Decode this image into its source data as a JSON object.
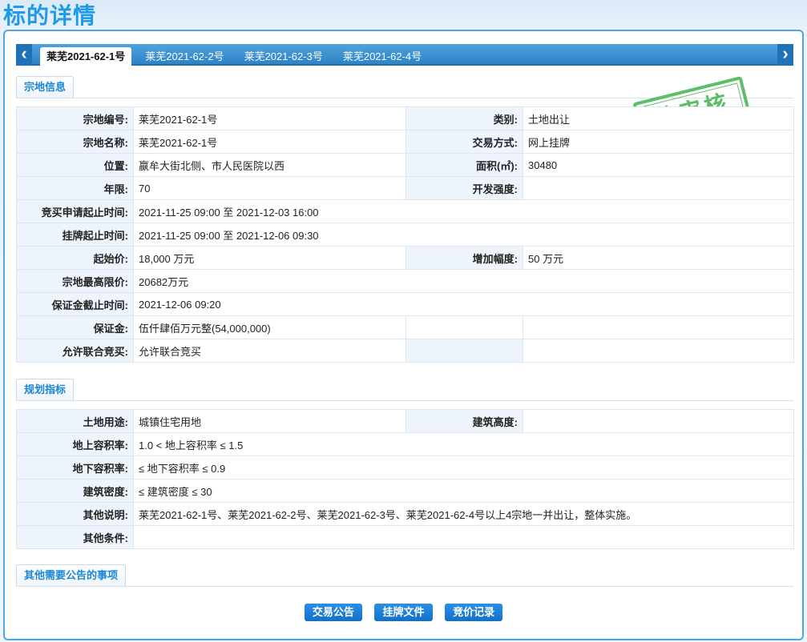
{
  "page_title": "标的详情",
  "tabs": [
    "莱芜2021-62-1号",
    "莱芜2021-62-2号",
    "莱芜2021-62-3号",
    "莱芜2021-62-4号"
  ],
  "stamp_text": "待审核",
  "section1": {
    "title": "宗地信息",
    "land_no_label": "宗地编号:",
    "land_no": "莱芜2021-62-1号",
    "category_label": "类别:",
    "category": "土地出让",
    "land_name_label": "宗地名称:",
    "land_name": "莱芜2021-62-1号",
    "trade_method_label": "交易方式:",
    "trade_method": "网上挂牌",
    "location_label": "位置:",
    "location": "嬴牟大街北侧、市人民医院以西",
    "area_label": "面积(㎡):",
    "area": "30480",
    "term_label": "年限:",
    "term": "70",
    "dev_intensity_label": "开发强度:",
    "dev_intensity": "",
    "bid_apply_period_label": "竞买申请起止时间:",
    "bid_apply_period": "2021-11-25 09:00 至 2021-12-03 16:00",
    "listing_period_label": "挂牌起止时间:",
    "listing_period": "2021-11-25 09:00 至 2021-12-06 09:30",
    "start_price_label": "起始价:",
    "start_price": "18,000 万元",
    "increment_label": "增加幅度:",
    "increment": "50 万元",
    "max_price_label": "宗地最高限价:",
    "max_price": "20682万元",
    "deposit_deadline_label": "保证金截止时间:",
    "deposit_deadline": "2021-12-06 09:20",
    "deposit_label": "保证金:",
    "deposit": "伍仟肆佰万元整(54,000,000)",
    "joint_bid_label": "允许联合竞买:",
    "joint_bid": "允许联合竞买"
  },
  "section2": {
    "title": "规划指标",
    "land_use_label": "土地用途:",
    "land_use": "城镇住宅用地",
    "height_label": "建筑高度:",
    "height": "",
    "far_label": "地上容积率:",
    "far": "1.0 < 地上容积率 ≤ 1.5",
    "underground_far_label": "地下容积率:",
    "underground_far": "≤ 地下容积率 ≤ 0.9",
    "density_label": "建筑密度:",
    "density": "≤ 建筑密度 ≤ 30",
    "notes_label": "其他说明:",
    "notes": "莱芜2021-62-1号、莱芜2021-62-2号、莱芜2021-62-3号、莱芜2021-62-4号以上4宗地一并出让，整体实施。",
    "conditions_label": "其他条件:",
    "conditions": ""
  },
  "section3": {
    "title": "其他需要公告的事项"
  },
  "buttons": {
    "announcement": "交易公告",
    "listing_docs": "挂牌文件",
    "bid_record": "竞价记录"
  }
}
